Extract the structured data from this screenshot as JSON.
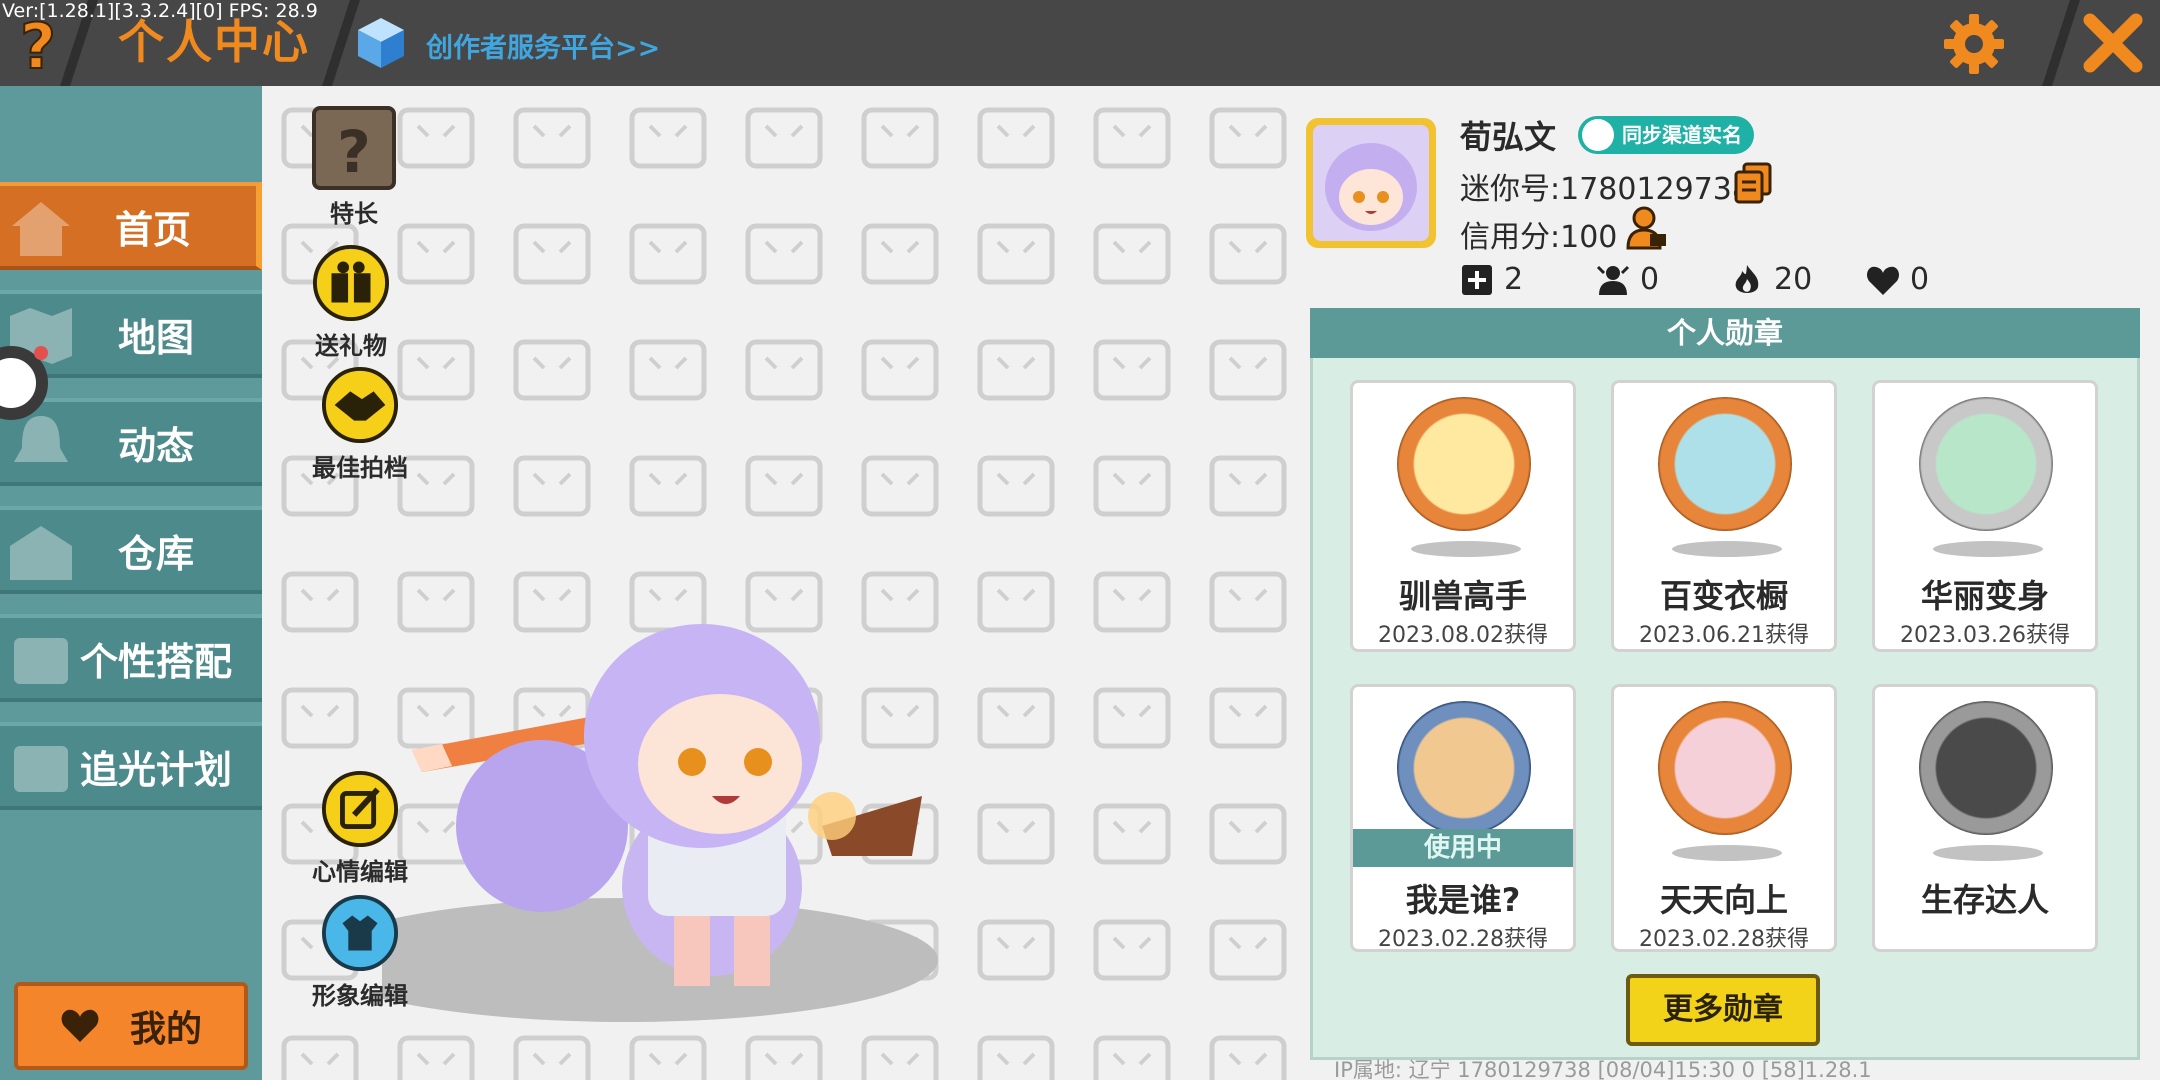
{
  "debug": {
    "version_text": "Ver:[1.28.1][3.3.2.4][0] FPS: 28.9"
  },
  "header": {
    "title": "个人中心",
    "creator_link": "创作者服务平台>>"
  },
  "sidebar": {
    "items": [
      {
        "label": "首页",
        "icon": "home-icon",
        "active": true
      },
      {
        "label": "地图",
        "icon": "map-icon",
        "active": false
      },
      {
        "label": "动态",
        "icon": "bell-icon",
        "active": false
      },
      {
        "label": "仓库",
        "icon": "warehouse-icon",
        "active": false
      },
      {
        "label": "个性搭配",
        "icon": "outfit-icon",
        "active": false
      },
      {
        "label": "追光计划",
        "icon": "plan-icon",
        "active": false
      }
    ],
    "my_button": "我的"
  },
  "functions": {
    "skill": "特长",
    "gift": "送礼物",
    "partner": "最佳拍档",
    "mood": "心情编辑",
    "appearance": "形象编辑"
  },
  "profile": {
    "name": "荀弘文",
    "verify_badge": "同步渠道实名",
    "mini_id": "迷你号:1780129738",
    "credit": "信用分:100",
    "stats": [
      {
        "icon": "add-friend-icon",
        "value": "2"
      },
      {
        "icon": "fans-icon",
        "value": "0"
      },
      {
        "icon": "fire-icon",
        "value": "20"
      },
      {
        "icon": "heart-icon",
        "value": "0"
      }
    ]
  },
  "medals": {
    "title": "个人勋章",
    "items": [
      {
        "name": "驯兽高手",
        "date": "2023.08.02获得",
        "color": "#e7863a"
      },
      {
        "name": "百变衣橱",
        "date": "2023.06.21获得",
        "color": "#e7863a"
      },
      {
        "name": "华丽变身",
        "date": "2023.03.26获得",
        "color": "#a9a9a9"
      },
      {
        "name": "我是谁?",
        "date": "2023.02.28获得",
        "color": "#4b6fa5",
        "status": "使用中"
      },
      {
        "name": "天天向上",
        "date": "2023.02.28获得",
        "color": "#e7863a"
      },
      {
        "name": "生存达人",
        "date": "",
        "color": "#8a8a8a"
      }
    ],
    "more_button": "更多勋章"
  },
  "footer": {
    "info": "IP属地: 辽宁  1780129738   [08/04]15:30 0  [58]1.28.1"
  },
  "colors": {
    "accent_orange": "#f08a1e",
    "nav_teal": "#4d8a8c",
    "nav_active": "#d46f24"
  }
}
